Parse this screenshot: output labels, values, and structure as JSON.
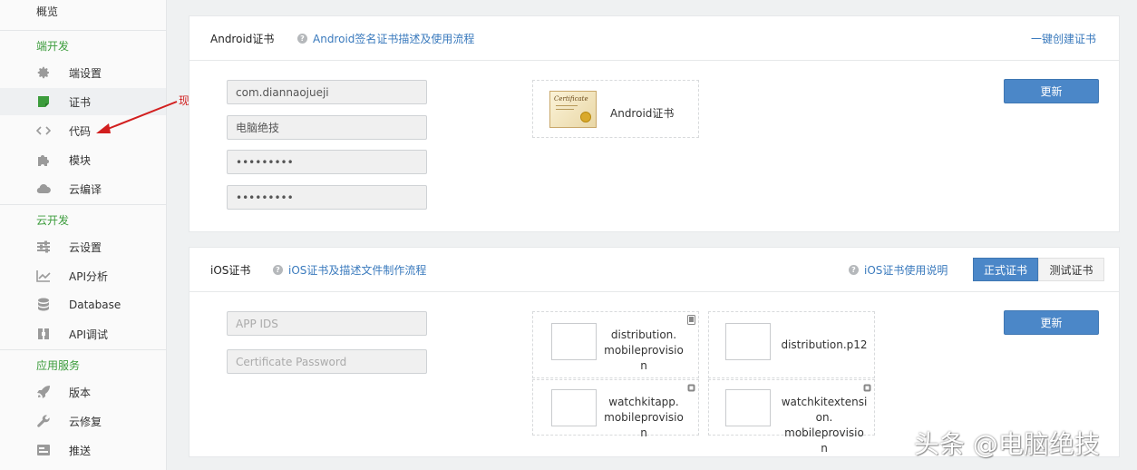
{
  "sidebar": {
    "top_item": "概览",
    "sections": {
      "client": "端开发",
      "cloud": "云开发",
      "services": "应用服务"
    },
    "items": [
      {
        "label": "端设置",
        "icon": "gear-icon"
      },
      {
        "label": "证书",
        "icon": "certificate-icon"
      },
      {
        "label": "代码",
        "icon": "code-icon"
      },
      {
        "label": "模块",
        "icon": "puzzle-icon"
      },
      {
        "label": "云编译",
        "icon": "cloud-icon"
      },
      {
        "label": "云设置",
        "icon": "sliders-icon"
      },
      {
        "label": "API分析",
        "icon": "chart-icon"
      },
      {
        "label": "Database",
        "icon": "database-icon"
      },
      {
        "label": "API调试",
        "icon": "debug-icon"
      },
      {
        "label": "版本",
        "icon": "rocket-icon"
      },
      {
        "label": "云修复",
        "icon": "wrench-icon"
      },
      {
        "label": "推送",
        "icon": "push-icon"
      }
    ]
  },
  "annotation": "现在点代码",
  "android": {
    "title": "Android证书",
    "help_link": "Android签名证书描述及使用流程",
    "create_link": "一键创建证书",
    "fields": {
      "package": "com.diannaojueji",
      "name": "电脑绝技",
      "password1": "•••••••••",
      "password2": "•••••••••"
    },
    "cert_label": "Android证书",
    "cert_image_text": "Certificate",
    "update_button": "更新"
  },
  "ios": {
    "title": "iOS证书",
    "help_link": "iOS证书及描述文件制作流程",
    "usage_link": "iOS证书使用说明",
    "tabs": {
      "official": "正式证书",
      "test": "测试证书"
    },
    "fields": {
      "app_ids_placeholder": "APP IDS",
      "cert_password_placeholder": "Certificate Password"
    },
    "files": {
      "dist_mp_1": "distribution.",
      "dist_mp_2": "mobileprovisio",
      "dist_mp_3": "n",
      "dist_p12": "distribution.p12",
      "watch_app_1": "watchkitapp.",
      "watch_app_2": "mobileprovisio",
      "watch_app_3": "n",
      "watch_ext_1": "watchkitextensi",
      "watch_ext_2": "on.",
      "watch_ext_3": "mobileprovisio",
      "watch_ext_4": "n"
    },
    "update_button": "更新"
  },
  "watermark": "头条 @电脑绝技",
  "colors": {
    "accent_blue": "#4b87c8",
    "section_green": "#3c9c3c",
    "link_blue": "#3a7abd",
    "annotation_red": "#d21f1f"
  }
}
